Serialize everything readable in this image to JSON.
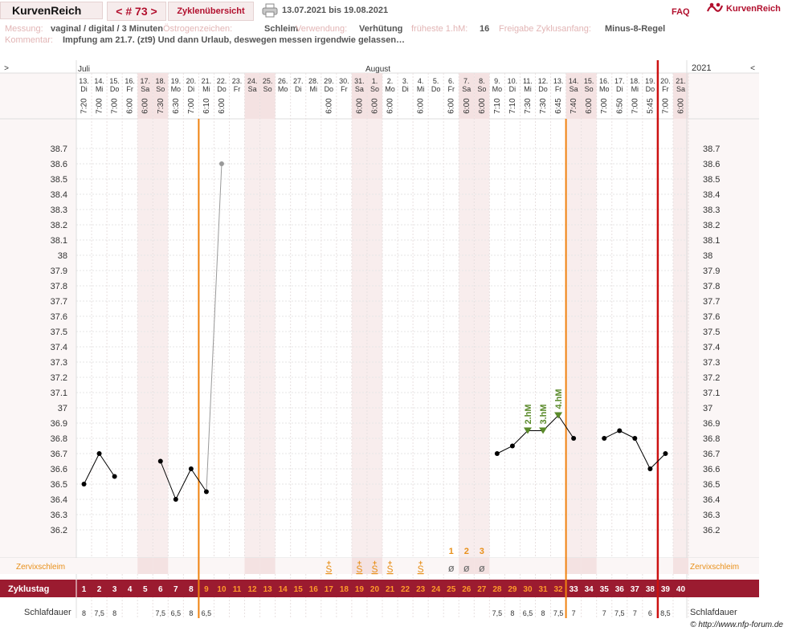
{
  "header": {
    "brand": "KurvenReich",
    "cycle_label": "< # 73 >",
    "overview_label": "Zyklenübersicht",
    "date_range": "13.07.2021 bis 19.08.2021",
    "faq": "FAQ",
    "logo_text": "KurvenReich"
  },
  "info": {
    "measurement_label": "Messung:",
    "measurement_value": "vaginal / digital / 3 Minuten",
    "estrogen_label": "Östrogenzeichen:",
    "estrogen_value": "Schleim",
    "usage_label": "Verwendung:",
    "usage_value": "Verhütung",
    "earliest_label": "früheste 1.hM:",
    "earliest_value": "16",
    "release_label": "Freigabe Zyklusanfang:",
    "release_value": "Minus-8-Regel",
    "comment_label": "Kommentar:",
    "comment_value": "Impfung am 21.7. (zt9) Und dann Urlaub, deswegen messen irgendwie gelassen…"
  },
  "chart": {
    "nav_left": ">",
    "nav_right": "<",
    "year": "2021",
    "month_july": "Juli",
    "month_august": "August",
    "y_ticks": [
      "38.7",
      "38.6",
      "38.5",
      "38.4",
      "38.3",
      "38.2",
      "38.1",
      "38",
      "37.9",
      "37.8",
      "37.7",
      "37.6",
      "37.5",
      "37.4",
      "37.3",
      "37.2",
      "37.1",
      "37",
      "36.9",
      "36.8",
      "36.7",
      "36.6",
      "36.5",
      "36.4",
      "36.3",
      "36.2"
    ],
    "zervix_label": "Zervixschleim",
    "cycle_day_label": "Zyklustag",
    "sleep_label": "Schlafdauer",
    "markers": {
      "hm2": "2.hM",
      "hm3": "3.hM",
      "hm4": "4.hM"
    },
    "mucus_numbers": [
      "1",
      "2",
      "3"
    ],
    "mucus_s": "S",
    "mucus_dry": "ø",
    "mucus_plus": "+"
  },
  "days": [
    {
      "d": "13.",
      "w": "Di",
      "t": "7:20",
      "cd": "1",
      "sl": "8",
      "we": false
    },
    {
      "d": "14.",
      "w": "Mi",
      "t": "7:00",
      "cd": "2",
      "sl": "7,5",
      "we": false
    },
    {
      "d": "15.",
      "w": "Do",
      "t": "7:00",
      "cd": "3",
      "sl": "8",
      "we": false
    },
    {
      "d": "16.",
      "w": "Fr",
      "t": "6:00",
      "cd": "4",
      "sl": "",
      "we": false
    },
    {
      "d": "17.",
      "w": "Sa",
      "t": "6:00",
      "cd": "5",
      "sl": "",
      "we": true
    },
    {
      "d": "18.",
      "w": "So",
      "t": "7:30",
      "cd": "6",
      "sl": "7,5",
      "we": true
    },
    {
      "d": "19.",
      "w": "Mo",
      "t": "6:30",
      "cd": "7",
      "sl": "6,5",
      "we": false
    },
    {
      "d": "20.",
      "w": "Di",
      "t": "7:00",
      "cd": "8",
      "sl": "8",
      "we": false
    },
    {
      "d": "21.",
      "w": "Mi",
      "t": "6:10",
      "cd": "9",
      "sl": "6,5",
      "we": false
    },
    {
      "d": "22.",
      "w": "Do",
      "t": "6:00",
      "cd": "10",
      "sl": "",
      "we": false
    },
    {
      "d": "23.",
      "w": "Fr",
      "t": "",
      "cd": "11",
      "sl": "",
      "we": false
    },
    {
      "d": "24.",
      "w": "Sa",
      "t": "",
      "cd": "12",
      "sl": "",
      "we": true
    },
    {
      "d": "25.",
      "w": "So",
      "t": "",
      "cd": "13",
      "sl": "",
      "we": true
    },
    {
      "d": "26.",
      "w": "Mo",
      "t": "",
      "cd": "14",
      "sl": "",
      "we": false
    },
    {
      "d": "27.",
      "w": "Di",
      "t": "",
      "cd": "15",
      "sl": "",
      "we": false
    },
    {
      "d": "28.",
      "w": "Mi",
      "t": "",
      "cd": "16",
      "sl": "",
      "we": false
    },
    {
      "d": "29.",
      "w": "Do",
      "t": "6:00",
      "cd": "17",
      "sl": "",
      "we": false
    },
    {
      "d": "30.",
      "w": "Fr",
      "t": "",
      "cd": "18",
      "sl": "",
      "we": false
    },
    {
      "d": "31.",
      "w": "Sa",
      "t": "6:00",
      "cd": "19",
      "sl": "",
      "we": true
    },
    {
      "d": "1.",
      "w": "So",
      "t": "6:00",
      "cd": "20",
      "sl": "",
      "we": true
    },
    {
      "d": "2.",
      "w": "Mo",
      "t": "6:00",
      "cd": "21",
      "sl": "",
      "we": false
    },
    {
      "d": "3.",
      "w": "Di",
      "t": "",
      "cd": "22",
      "sl": "",
      "we": false
    },
    {
      "d": "4.",
      "w": "Mi",
      "t": "6:00",
      "cd": "23",
      "sl": "",
      "we": false
    },
    {
      "d": "5.",
      "w": "Do",
      "t": "",
      "cd": "24",
      "sl": "",
      "we": false
    },
    {
      "d": "6.",
      "w": "Fr",
      "t": "6:00",
      "cd": "25",
      "sl": "",
      "we": false
    },
    {
      "d": "7.",
      "w": "Sa",
      "t": "6:00",
      "cd": "26",
      "sl": "",
      "we": true
    },
    {
      "d": "8.",
      "w": "So",
      "t": "6:00",
      "cd": "27",
      "sl": "",
      "we": true
    },
    {
      "d": "9.",
      "w": "Mo",
      "t": "7:10",
      "cd": "28",
      "sl": "7,5",
      "we": false
    },
    {
      "d": "10.",
      "w": "Di",
      "t": "7:10",
      "cd": "29",
      "sl": "8",
      "we": false
    },
    {
      "d": "11.",
      "w": "Mi",
      "t": "7:30",
      "cd": "30",
      "sl": "6,5",
      "we": false
    },
    {
      "d": "12.",
      "w": "Do",
      "t": "7:30",
      "cd": "31",
      "sl": "8",
      "we": false
    },
    {
      "d": "13.",
      "w": "Fr",
      "t": "6:45",
      "cd": "32",
      "sl": "7,5",
      "we": false
    },
    {
      "d": "14.",
      "w": "Sa",
      "t": "7:40",
      "cd": "33",
      "sl": "7",
      "we": true
    },
    {
      "d": "15.",
      "w": "So",
      "t": "6:00",
      "cd": "34",
      "sl": "",
      "we": true
    },
    {
      "d": "16.",
      "w": "Mo",
      "t": "7:00",
      "cd": "35",
      "sl": "7",
      "we": false
    },
    {
      "d": "17.",
      "w": "Di",
      "t": "6:50",
      "cd": "36",
      "sl": "7,5",
      "we": false
    },
    {
      "d": "18.",
      "w": "Mi",
      "t": "7:00",
      "cd": "37",
      "sl": "7",
      "we": false
    },
    {
      "d": "19.",
      "w": "Do",
      "t": "5:45",
      "cd": "38",
      "sl": "6",
      "we": false
    },
    {
      "d": "20.",
      "w": "Fr",
      "t": "7:00",
      "cd": "39",
      "sl": "8,5",
      "we": false
    },
    {
      "d": "21.",
      "w": "Sa",
      "t": "6:00",
      "cd": "40",
      "sl": "",
      "we": true
    }
  ],
  "chart_data": {
    "type": "line",
    "xlabel": "Zyklustag",
    "ylim": [
      36.2,
      38.7
    ],
    "series": [
      {
        "values": [
          36.5,
          36.7,
          36.55,
          null,
          null,
          36.65,
          36.4,
          36.6,
          36.45,
          38.6,
          null,
          null,
          null,
          null,
          null,
          null,
          null,
          null,
          null,
          null,
          null,
          null,
          null,
          null,
          null,
          null,
          null,
          36.7,
          36.75,
          36.85,
          36.85,
          36.95,
          36.8,
          null,
          36.8,
          36.85,
          36.8,
          36.6,
          36.7,
          null
        ]
      }
    ],
    "temperature_points": [
      {
        "cd": 1,
        "y": 36.5
      },
      {
        "cd": 2,
        "y": 36.7
      },
      {
        "cd": 3,
        "y": 36.55
      },
      {
        "cd": 6,
        "y": 36.65
      },
      {
        "cd": 7,
        "y": 36.4
      },
      {
        "cd": 8,
        "y": 36.6
      },
      {
        "cd": 9,
        "y": 36.45
      },
      {
        "cd": 10,
        "y": 38.6,
        "excluded": true
      },
      {
        "cd": 28,
        "y": 36.7
      },
      {
        "cd": 29,
        "y": 36.75
      },
      {
        "cd": 30,
        "y": 36.85,
        "marker": "2.hM"
      },
      {
        "cd": 31,
        "y": 36.85,
        "marker": "3.hM"
      },
      {
        "cd": 32,
        "y": 36.95,
        "marker": "4.hM"
      },
      {
        "cd": 33,
        "y": 36.8
      },
      {
        "cd": 35,
        "y": 36.8
      },
      {
        "cd": 36,
        "y": 36.85
      },
      {
        "cd": 37,
        "y": 36.8
      },
      {
        "cd": 38,
        "y": 36.6
      },
      {
        "cd": 39,
        "y": 36.7
      }
    ],
    "cervical_mucus": [
      {
        "cd": 17,
        "code": "S+"
      },
      {
        "cd": 19,
        "code": "S+"
      },
      {
        "cd": 20,
        "code": "S+"
      },
      {
        "cd": 21,
        "code": "S+"
      },
      {
        "cd": 23,
        "code": "S+"
      },
      {
        "cd": 25,
        "code": "ø",
        "peak_count": "1"
      },
      {
        "cd": 26,
        "code": "ø",
        "peak_count": "2"
      },
      {
        "cd": 27,
        "code": "ø",
        "peak_count": "3"
      }
    ],
    "orange_lines_after_cd": [
      8,
      32
    ],
    "red_line_after_cd": 38,
    "colors": {
      "temp": "#000000",
      "excluded": "#999999",
      "orange": "#f0820f",
      "red": "#cc1111",
      "cycle_bar": "#9b1b30",
      "hm_marker": "#5a8a2a"
    }
  }
}
